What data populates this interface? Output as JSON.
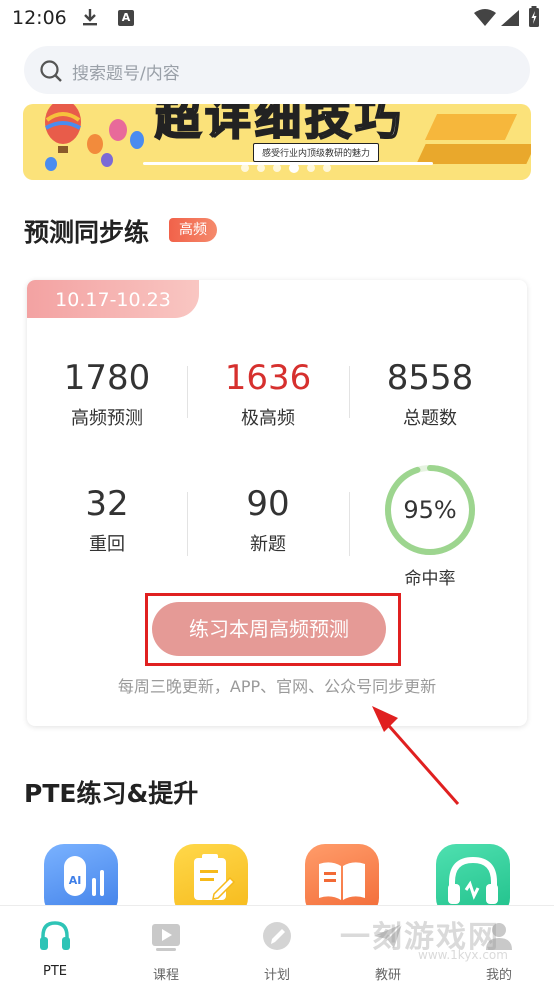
{
  "status_bar": {
    "time": "12:06"
  },
  "search": {
    "placeholder": "搜索题号/内容"
  },
  "banner": {
    "subtitle": "感受行业内顶级教研的魅力"
  },
  "weekly": {
    "title": "预测同步练",
    "badge": "高频",
    "date_range": "10.17-10.23",
    "stats": [
      {
        "value": "1780",
        "label": "高频预测"
      },
      {
        "value": "1636",
        "label": "极高频",
        "color": "#d6302e"
      },
      {
        "value": "8558",
        "label": "总题数"
      },
      {
        "value": "32",
        "label": "重回"
      },
      {
        "value": "90",
        "label": "新题"
      }
    ],
    "hit_rate": {
      "value": "95%",
      "label": "命中率",
      "fraction": 0.95
    },
    "cta_label": "练习本周高频预测",
    "note": "每周三晚更新，APP、官网、公众号同步更新"
  },
  "practice": {
    "title": "PTE练习&提升",
    "tools": [
      {
        "icon": "ai-mic-icon",
        "color": "#4a8cf0"
      },
      {
        "icon": "notepad-icon",
        "color": "#f7c326"
      },
      {
        "icon": "book-icon",
        "color": "#f57a45"
      },
      {
        "icon": "headphones-icon",
        "color": "#2fcf9a"
      }
    ]
  },
  "bottom_nav": [
    {
      "label": "PTE",
      "icon": "headphones-icon",
      "active": true
    },
    {
      "label": "课程",
      "icon": "video-icon",
      "active": false
    },
    {
      "label": "计划",
      "icon": "pencil-icon",
      "active": false
    },
    {
      "label": "教研",
      "icon": "paper-plane-icon",
      "active": false
    },
    {
      "label": "我的",
      "icon": "user-icon",
      "active": false
    }
  ],
  "watermark": {
    "text": "一刻游戏网",
    "url": "www.1kyx.com"
  },
  "colors": {
    "accent": "#2ec4b6",
    "cta": "#e59a96",
    "highlight": "#d6302e"
  }
}
